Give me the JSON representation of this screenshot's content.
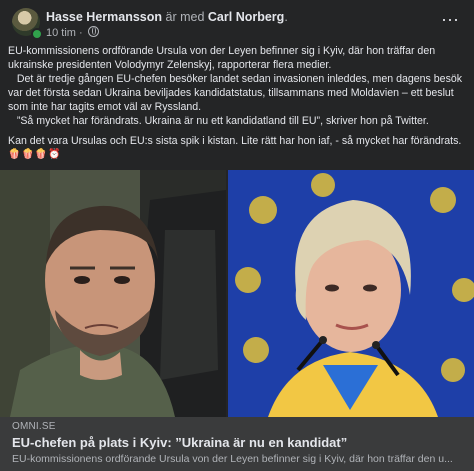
{
  "post": {
    "author": "Hasse Hermansson",
    "with_text": "är med",
    "tagged": "Carl Norberg",
    "tagged_suffix": ".",
    "time": "10 tim",
    "time_separator": "·",
    "more_label": "···",
    "lines": [
      "EU-kommissionens ordförande Ursula von der Leyen befinner sig i Kyiv, där hon träffar den",
      "ukrainske presidenten Volodymyr Zelenskyj, rapporterar flera medier.",
      "   Det är tredje gången EU-chefen besöker landet sedan invasionen inleddes, men dagens besök",
      "var det första sedan Ukraina beviljades kandidatstatus, tillsammans med Moldavien – ett beslut",
      "som inte har tagits emot väl av Ryssland.",
      "   ”Så mycket har förändrats. Ukraina är nu ett kandidatland till EU”, skriver hon på Twitter."
    ],
    "comment": "Kan det vara Ursulas och EU:s sista spik i kistan. Lite rätt har hon iaf, - så mycket har förändrats.",
    "emojis": "🍿🍿🍿⏰"
  },
  "link": {
    "domain": "OMNI.SE",
    "title": "EU-chefen på plats i Kyiv: ”Ukraina är nu en kandidat”",
    "description": "EU-kommissionens ordförande Ursula von der Leyen befinner sig i Kyiv, där hon träffar den u..."
  },
  "colors": {
    "background": "#242526",
    "card": "#3a3b3c",
    "text": "#e4e6eb",
    "muted": "#b0b3b8",
    "online": "#31a24c",
    "eu_blue": "#1e3fa8",
    "eu_star": "#ffcc00"
  }
}
